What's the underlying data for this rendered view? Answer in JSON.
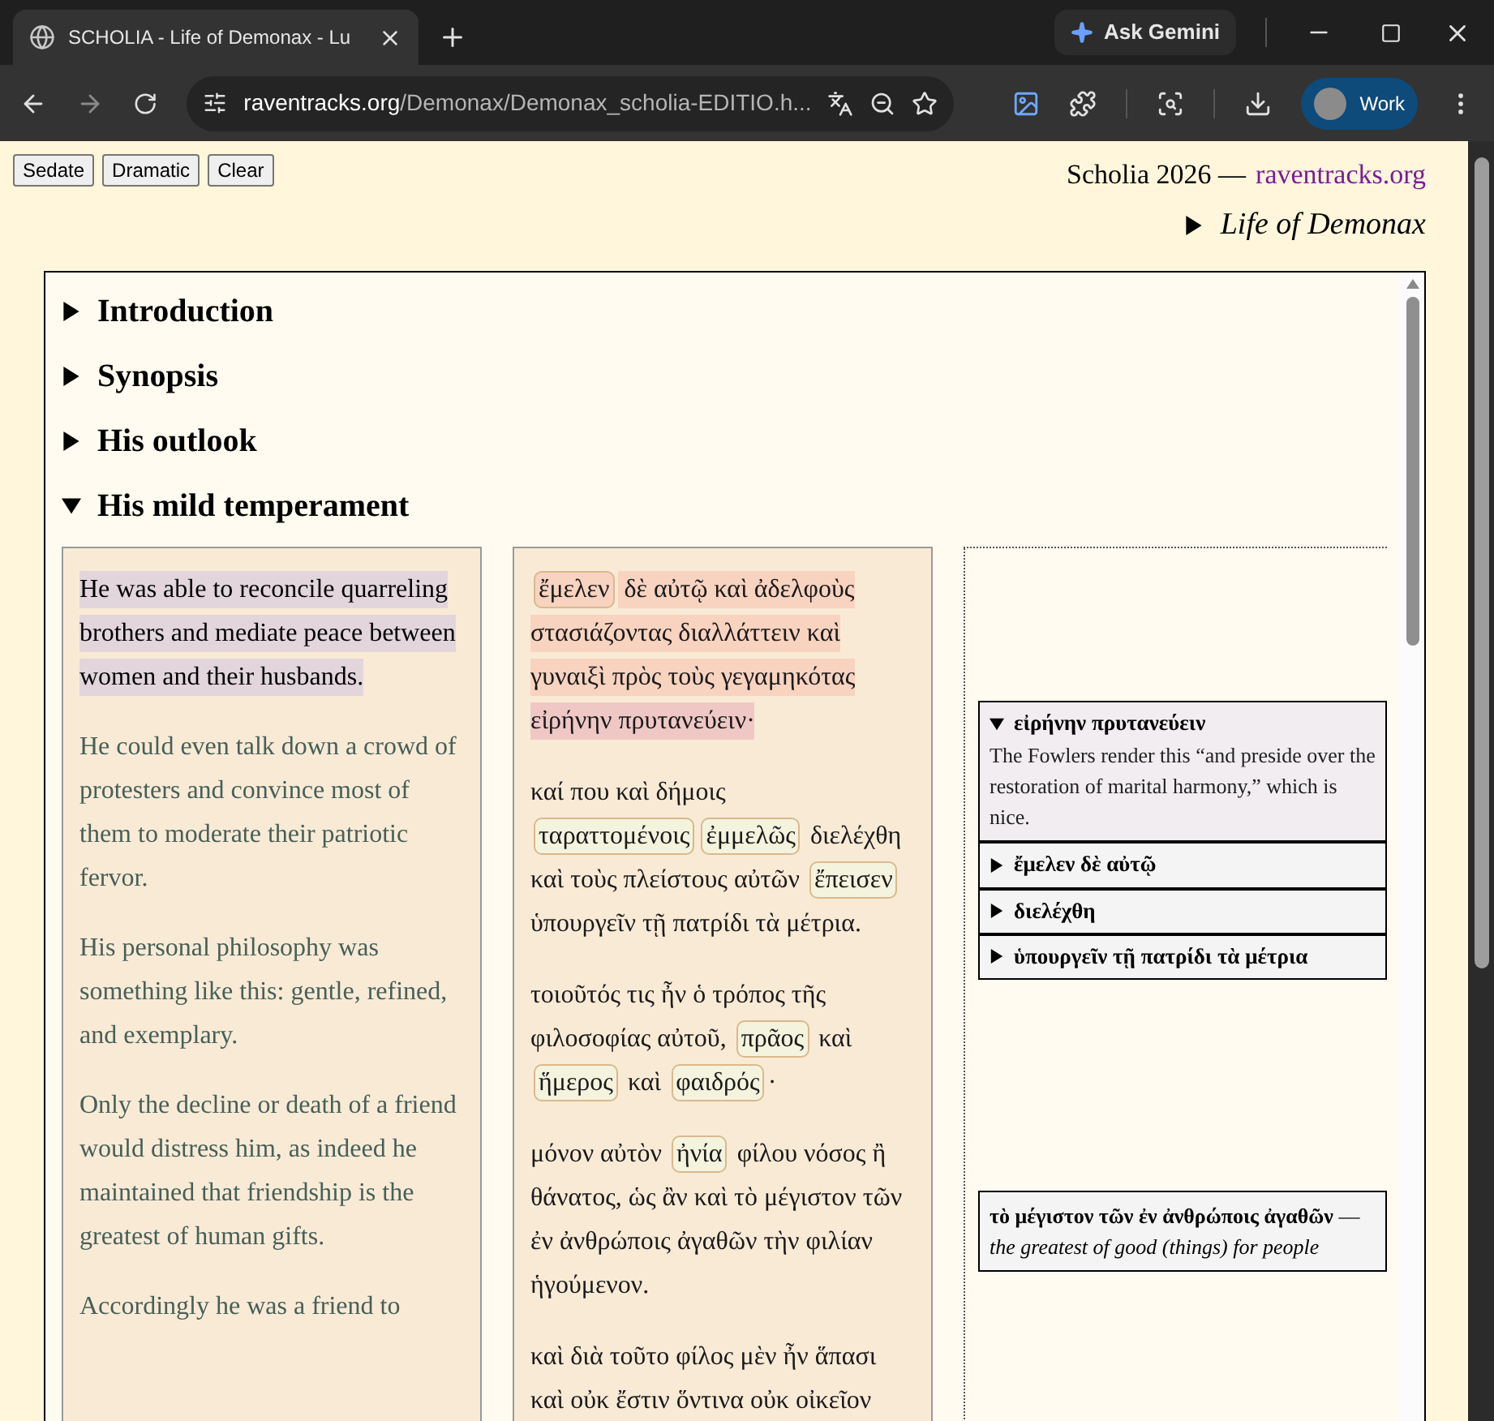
{
  "browser": {
    "tab_title": "SCHOLIA - Life of Demonax - Lu",
    "ask_button": "Ask Gemini",
    "url_host": "raventracks.org",
    "url_path": "/Demonax/Demonax_scholia-EDITIO.h...",
    "profile": "Work"
  },
  "buttons": [
    "Sedate",
    "Dramatic",
    "Clear"
  ],
  "header": {
    "title": "Scholia 2026 —",
    "link": "raventracks.org",
    "nav": {
      "label": "Life of Demonax",
      "expanded": false
    }
  },
  "sections": [
    {
      "title": "Introduction",
      "expanded": false
    },
    {
      "title": "Synopsis",
      "expanded": false
    },
    {
      "title": "His outlook",
      "expanded": false
    },
    {
      "title": "His mild temperament",
      "expanded": true
    }
  ],
  "translation": [
    {
      "text": "He was able to reconcile quarreling brothers and mediate peace between women and their husbands.",
      "highlighted": true
    },
    {
      "text": "He could even talk down a crowd of protesters and convince most of them to moderate their patriotic fervor.",
      "highlighted": false
    },
    {
      "text": "His personal philosophy was something like this: gentle, refined, and exemplary.",
      "highlighted": false
    },
    {
      "text": "Only the decline or death of a friend would distress him, as indeed he maintained that friendship is the greatest of human gifts.",
      "highlighted": false
    },
    {
      "text": "Accordingly he was a friend to",
      "highlighted": false
    }
  ],
  "greek": [
    {
      "highlighted": true,
      "segments": [
        {
          "kind": "gloss",
          "text": "ἔμελεν"
        },
        {
          "kind": "plain",
          "text": " δὲ αὐτῷ καὶ ἀδελφοὺς στασιάζοντας διαλλάττειν καὶ γυναιξὶ πρὸς τοὺς γεγαμηκότας "
        },
        {
          "kind": "active",
          "text": "εἰρήνην πρυτανεύειν·"
        }
      ]
    },
    {
      "highlighted": false,
      "segments": [
        {
          "kind": "plain",
          "text": "καί που καὶ δήμοις "
        },
        {
          "kind": "gloss",
          "text": "ταραττομένοις"
        },
        {
          "kind": "gloss",
          "text": "ἐμμελῶς"
        },
        {
          "kind": "plain",
          "text": " διελέχθη καὶ τοὺς πλείστους αὐτῶν "
        },
        {
          "kind": "gloss",
          "text": "ἔπεισεν"
        },
        {
          "kind": "plain",
          "text": " ὑπουργεῖν τῇ πατρίδι τὰ μέτρια."
        }
      ]
    },
    {
      "highlighted": false,
      "segments": [
        {
          "kind": "plain",
          "text": "τοιοῦτός τις ἦν ὁ τρόπος τῆς φιλοσοφίας αὐτοῦ, "
        },
        {
          "kind": "gloss",
          "text": "πρᾶος"
        },
        {
          "kind": "plain",
          "text": " καὶ "
        },
        {
          "kind": "gloss",
          "text": "ἥμερος"
        },
        {
          "kind": "plain",
          "text": " καὶ "
        },
        {
          "kind": "gloss",
          "text": "φαιδρός"
        },
        {
          "kind": "plain",
          "text": "·"
        }
      ]
    },
    {
      "highlighted": false,
      "segments": [
        {
          "kind": "plain",
          "text": "μόνον αὐτὸν "
        },
        {
          "kind": "gloss",
          "text": "ἠνία"
        },
        {
          "kind": "plain",
          "text": " φίλου νόσος ἢ θάνατος, ὡς ἂν καὶ τὸ μέγιστον τῶν ἐν ἀνθρώποις ἀγαθῶν τὴν φιλίαν ἡγούμενον."
        }
      ]
    },
    {
      "highlighted": false,
      "segments": [
        {
          "kind": "plain",
          "text": "καὶ διὰ τοῦτο φίλος μὲν ἦν ἅπασι καὶ οὐκ ἔστιν ὅντινα οὐκ οἰκεῖον"
        }
      ]
    }
  ],
  "notes": [
    {
      "title": "εἰρήνην πρυτανεύειν",
      "expanded": true,
      "body": "The Fowlers render this “and preside over the restoration of marital harmony,” which is nice."
    },
    {
      "title": "ἔμελεν δὲ αὐτῷ",
      "expanded": false
    },
    {
      "title": "διελέχθη",
      "expanded": false
    },
    {
      "title": "ὑπουργεῖν τῇ πατρίδι τὰ μέτρια",
      "expanded": false
    }
  ],
  "footnote": "**τὸ μέγιστον τῶν ἐν ἀνθρώποις ἀγαθῶν** — *the greatest of good (things) for people*"
}
